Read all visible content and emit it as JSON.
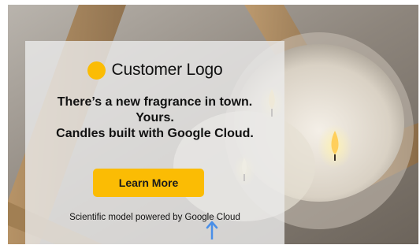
{
  "ad": {
    "logo_text": "Customer Logo",
    "headline": [
      "There’s a new fragrance in town.",
      "Yours.",
      "Candles built with Google Cloud."
    ],
    "cta_label": "Learn More",
    "disclaimer": "Scientific model powered by Google Cloud"
  },
  "colors": {
    "accent": "#fbbc04",
    "panel": "#ebebeb",
    "text": "#111111",
    "cursor": "#4a8fe8"
  },
  "icons": {
    "logo": "yellow-circle",
    "cursor": "arrow-up"
  }
}
